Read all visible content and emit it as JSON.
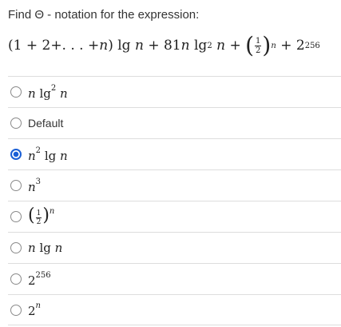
{
  "question": "Find Θ - notation for the expression:",
  "expression": {
    "open": "(1 + 2+. . . +",
    "n": "n",
    "close": ")",
    "lg1": "lg",
    "n2": "n",
    "plus1": "+",
    "coef": "81",
    "n3": "n",
    "lg2": "lg",
    "lg2_exp": "2",
    "n4": "n",
    "plus2": "+",
    "frac_num": "1",
    "frac_den": "2",
    "frac_exp": "n",
    "plus3": "+",
    "base": "2",
    "base_exp": "256"
  },
  "options": [
    {
      "pre": "n",
      "lg": "lg",
      "lg_exp": "2",
      "post": "n",
      "selected": false
    },
    {
      "label": "Default",
      "selected": false
    },
    {
      "base": "n",
      "base_exp": "2",
      "lg": "lg",
      "post": "n",
      "selected": true
    },
    {
      "base": "n",
      "base_exp": "3",
      "selected": false
    },
    {
      "frac_num": "1",
      "frac_den": "2",
      "exp": "n",
      "selected": false
    },
    {
      "pre": "n",
      "lg": "lg",
      "post": "n",
      "selected": false
    },
    {
      "base": "2",
      "base_exp": "256",
      "selected": false
    },
    {
      "base": "2",
      "base_exp": "n",
      "selected": false
    }
  ],
  "colors": {
    "accent": "#1a5fd6",
    "divider": "#dddddd"
  }
}
